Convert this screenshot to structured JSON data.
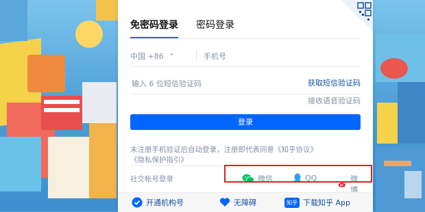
{
  "tabs": {
    "sms_login": "免密码登录",
    "password_login": "密码登录"
  },
  "phone": {
    "country_code": "中国 +86",
    "country_arrow": "⌃",
    "placeholder": "手机号"
  },
  "sms": {
    "placeholder": "输入 6 位短信验证码",
    "get_code": "获取短信验证码"
  },
  "voice_code": "接收语音验证码",
  "login_button": "登录",
  "agreement": {
    "text": "未注册手机验证后自动登录，注册即代表同意",
    "link1": "《知乎协议》",
    "link2": "《隐私保护指引》"
  },
  "social": {
    "label": "社交帐号登录",
    "wechat": "微信",
    "qq": "QQ",
    "weibo": "微博"
  },
  "footer": {
    "org": "开通机构号",
    "accessibility": "无障碍",
    "app": "下载知乎 App",
    "app_badge": "知乎"
  },
  "colors": {
    "accent": "#0066ff",
    "highlight": "#e02020",
    "wechat": "#07c160",
    "qq": "#3a9bf6",
    "weibo": "#e6162d"
  }
}
